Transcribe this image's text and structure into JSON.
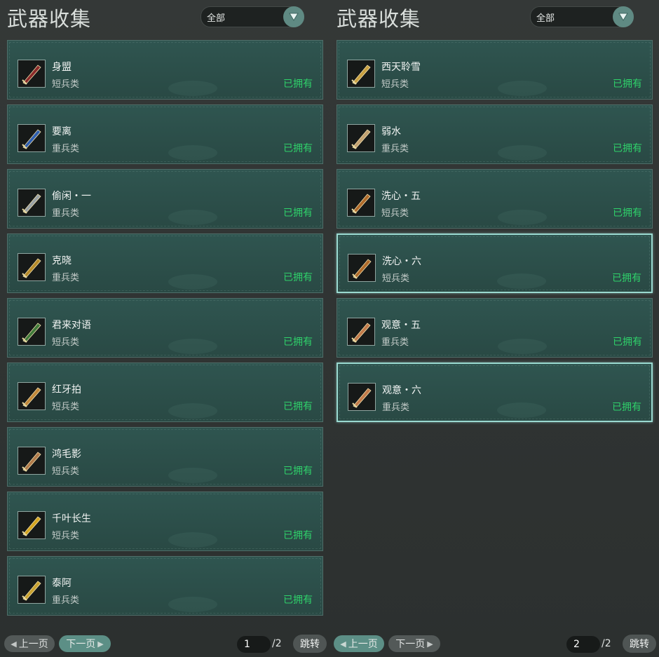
{
  "left_panel": {
    "title": "武器收集",
    "filter": {
      "value": "全部"
    },
    "items": [
      {
        "name": "身盟",
        "type": "短兵类",
        "status": "已拥有",
        "icon": "dark-sword-icon",
        "color": "#8a2a2a"
      },
      {
        "name": "要离",
        "type": "重兵类",
        "status": "已拥有",
        "icon": "blue-blade-icon",
        "color": "#2f5fb0"
      },
      {
        "name": "偷闲・一",
        "type": "重兵类",
        "status": "已拥有",
        "icon": "silver-blade-icon",
        "color": "#9aa2a6"
      },
      {
        "name": "克晓",
        "type": "重兵类",
        "status": "已拥有",
        "icon": "gold-blade-icon",
        "color": "#b58a2a"
      },
      {
        "name": "君来对语",
        "type": "短兵类",
        "status": "已拥有",
        "icon": "green-dagger-icon",
        "color": "#3f7a3a"
      },
      {
        "name": "红牙拍",
        "type": "短兵类",
        "status": "已拥有",
        "icon": "ornate-dagger-icon",
        "color": "#c2883a"
      },
      {
        "name": "鸿毛影",
        "type": "短兵类",
        "status": "已拥有",
        "icon": "feather-blade-icon",
        "color": "#b07a4a"
      },
      {
        "name": "千叶长生",
        "type": "短兵类",
        "status": "已拥有",
        "icon": "gold-ring-blade-icon",
        "color": "#d4a520"
      },
      {
        "name": "泰阿",
        "type": "重兵类",
        "status": "已拥有",
        "icon": "heavy-gold-blade-icon",
        "color": "#c9a230"
      }
    ],
    "pager": {
      "prev": "上一页",
      "next": "下一页",
      "current": "1",
      "total": "/2",
      "jump": "跳转"
    }
  },
  "right_panel": {
    "title": "武器收集",
    "filter": {
      "value": "全部"
    },
    "items": [
      {
        "name": "西天聆雪",
        "type": "短兵类",
        "status": "已拥有",
        "icon": "trident-icon",
        "color": "#c9a040",
        "selected": false
      },
      {
        "name": "弱水",
        "type": "重兵类",
        "status": "已拥有",
        "icon": "spear-head-icon",
        "color": "#c2a070",
        "selected": false
      },
      {
        "name": "洗心・五",
        "type": "短兵类",
        "status": "已拥有",
        "icon": "bronze-dagger-icon",
        "color": "#b06a2a",
        "selected": false
      },
      {
        "name": "洗心・六",
        "type": "短兵类",
        "status": "已拥有",
        "icon": "bronze-dagger-icon",
        "color": "#b06a2a",
        "selected": true
      },
      {
        "name": "观意・五",
        "type": "重兵类",
        "status": "已拥有",
        "icon": "copper-blade-icon",
        "color": "#c27a4a",
        "selected": false
      },
      {
        "name": "观意・六",
        "type": "重兵类",
        "status": "已拥有",
        "icon": "copper-blade-icon",
        "color": "#c27a4a",
        "selected": true
      }
    ],
    "pager": {
      "prev": "上一页",
      "next": "下一页",
      "current": "2",
      "total": "/2",
      "jump": "跳转"
    }
  },
  "colors": {
    "owned": "#2fd16a",
    "card_bg": "#2c504b",
    "accent": "#5f8a83"
  }
}
